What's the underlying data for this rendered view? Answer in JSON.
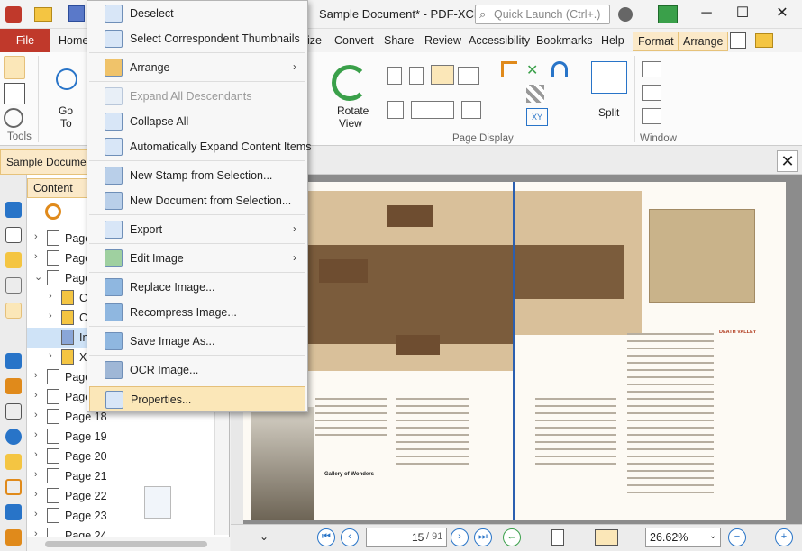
{
  "window": {
    "title": "Sample Document* - PDF-XCh...",
    "search_placeholder": "Quick Launch (Ctrl+.)",
    "minimize": "─",
    "maximize": "☐",
    "close": "✕"
  },
  "ribbon_tabs": {
    "file": "File",
    "home": "Home",
    "organize": "ize",
    "convert": "Convert",
    "share": "Share",
    "review": "Review",
    "accessibility": "Accessibility",
    "bookmarks": "Bookmarks",
    "help": "Help",
    "format": "Format",
    "arrange": "Arrange"
  },
  "ribbon": {
    "tools_label": "Tools",
    "goto_label_1": "Go",
    "goto_label_2": "To",
    "rotate_label_1": "Rotate",
    "rotate_label_2": "View",
    "page_display_label": "Page Display",
    "split_label": "Split",
    "window_label": "Window"
  },
  "document_tab": {
    "label": "Sample Documen",
    "close": "✕"
  },
  "content_panel": {
    "header": "Content",
    "rows": [
      {
        "label": "Page",
        "chev": "›",
        "type": "page"
      },
      {
        "label": "Page",
        "chev": "›",
        "type": "page"
      },
      {
        "label": "Page",
        "chev": "⌄",
        "type": "page"
      },
      {
        "label": "C",
        "chev": "›",
        "type": "folder"
      },
      {
        "label": "C",
        "chev": "›",
        "type": "folder"
      },
      {
        "label": "Im",
        "chev": "",
        "type": "image"
      },
      {
        "label": "XI",
        "chev": "›",
        "type": "xobj"
      },
      {
        "label": "Page",
        "chev": "›",
        "type": "page"
      },
      {
        "label": "Page",
        "chev": "›",
        "type": "page"
      },
      {
        "label": "Page 18",
        "chev": "›",
        "type": "page"
      },
      {
        "label": "Page 19",
        "chev": "›",
        "type": "page"
      },
      {
        "label": "Page 20",
        "chev": "›",
        "type": "page"
      },
      {
        "label": "Page 21",
        "chev": "›",
        "type": "page"
      },
      {
        "label": "Page 22",
        "chev": "›",
        "type": "page"
      },
      {
        "label": "Page 23",
        "chev": "›",
        "type": "page"
      },
      {
        "label": "Page 24",
        "chev": "›",
        "type": "page"
      }
    ]
  },
  "context_menu": {
    "items": [
      {
        "label": "Deselect",
        "icon": "deselect-icon",
        "disabled": false,
        "submenu": false
      },
      {
        "label": "Select Correspondent Thumbnails",
        "icon": "thumbnails-icon",
        "disabled": false,
        "submenu": false
      },
      {
        "label": "Arrange",
        "icon": "arrange-icon",
        "disabled": false,
        "submenu": true
      },
      {
        "label": "Expand All Descendants",
        "icon": "expand-icon",
        "disabled": true,
        "submenu": false
      },
      {
        "label": "Collapse All",
        "icon": "collapse-icon",
        "disabled": false,
        "submenu": false
      },
      {
        "label": "Automatically Expand Content Items",
        "icon": "auto-expand-icon",
        "disabled": false,
        "submenu": false
      },
      {
        "label": "New Stamp from Selection...",
        "icon": "stamp-icon",
        "disabled": false,
        "submenu": false
      },
      {
        "label": "New Document from Selection...",
        "icon": "new-document-icon",
        "disabled": false,
        "submenu": false
      },
      {
        "label": "Export",
        "icon": "export-icon",
        "disabled": false,
        "submenu": true
      },
      {
        "label": "Edit Image",
        "icon": "edit-image-icon",
        "disabled": false,
        "submenu": true
      },
      {
        "label": "Replace Image...",
        "icon": "replace-image-icon",
        "disabled": false,
        "submenu": false
      },
      {
        "label": "Recompress Image...",
        "icon": "recompress-icon",
        "disabled": false,
        "submenu": false
      },
      {
        "label": "Save Image As...",
        "icon": "save-image-icon",
        "disabled": false,
        "submenu": false
      },
      {
        "label": "OCR Image...",
        "icon": "ocr-icon",
        "disabled": false,
        "submenu": false
      },
      {
        "label": "Properties...",
        "icon": "properties-icon",
        "disabled": false,
        "submenu": false,
        "highlighted": true
      }
    ]
  },
  "page_content": {
    "left_heading": "Gallery of Wonders",
    "right_heading": "DEATH VALLEY"
  },
  "navigation": {
    "current_page": "15",
    "total_pages": "/ 91",
    "zoom": "26.62%"
  },
  "colors": {
    "file_tab": "#c0392b",
    "accent_hl": "#fbe7b8",
    "nav_blue": "#2874c8"
  }
}
